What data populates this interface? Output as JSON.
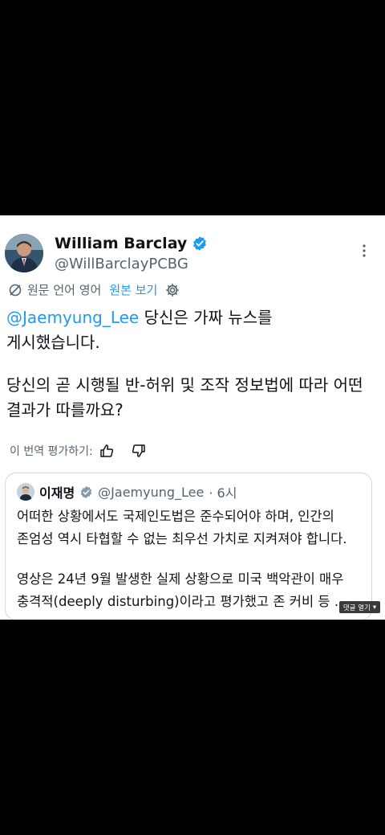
{
  "post": {
    "author_name": "William Barclay",
    "author_handle": "@WillBarclayPCBG",
    "translation": {
      "label": "원문 언어 영어",
      "show_original": "원본 보기"
    },
    "text": {
      "mention": "@Jaemyung_Lee",
      "line1_rest": " 당신은 가짜 뉴스를",
      "line2": "게시했습니다.",
      "line3": "당신의 곧 시행될 반-허위 및 조작 정보법에 따라 어떤",
      "line4": "결과가 따를까요?"
    },
    "rate_translation": "이 번역 평가하기:",
    "icons": {
      "translate": "translate-icon",
      "settings": "gear-icon",
      "more": "more-vertical-icon",
      "verified": "verified-badge-icon",
      "thumbs_up": "thumbs-up-icon",
      "thumbs_down": "thumbs-down-icon"
    }
  },
  "quote": {
    "author_name": "이재명",
    "author_handle": "@Jaemyung_Lee",
    "time": "· 6시",
    "lines": [
      "어떠한 상황에서도 국제인도법은 준수되어야 하며, 인간의",
      "존엄성 역시 타협할 수 없는 최우선 가치로 지켜져야 합니다.",
      "영상은 24년 9월 발생한 실제 상황으로 미국 백악관이 매우",
      "충격적(deeply disturbing)이라고 평가했고 존 커비 등 ..."
    ]
  },
  "overlay": {
    "comment_label": "댓글 열기",
    "arrow": "▾"
  },
  "colors": {
    "link_blue": "#1d9bf0",
    "text": "#0f1419",
    "secondary": "#536471",
    "background": "#000000"
  }
}
